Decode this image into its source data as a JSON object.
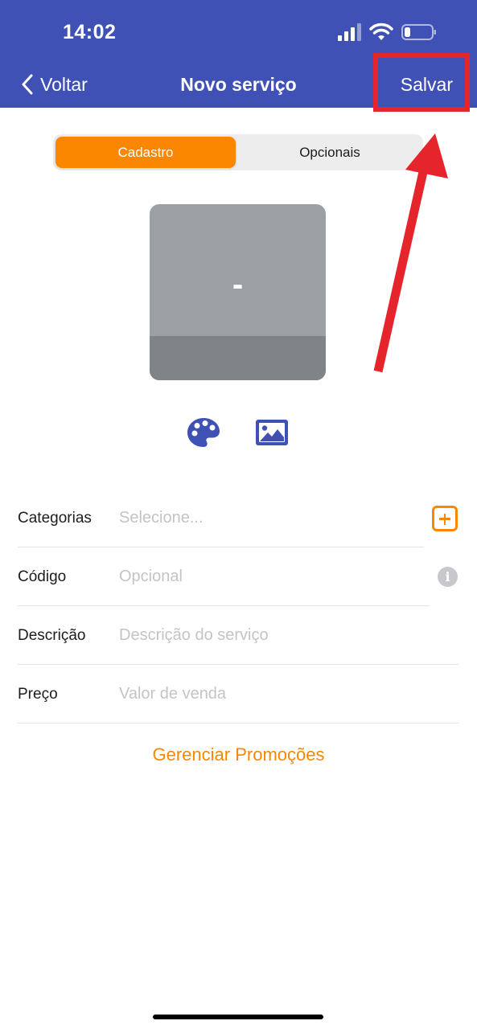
{
  "status_bar": {
    "time": "14:02"
  },
  "nav": {
    "back_label": "Voltar",
    "title": "Novo serviço",
    "save_label": "Salvar"
  },
  "segments": {
    "active": "Cadastro",
    "inactive": "Opcionais"
  },
  "preview": {
    "placeholder": "-"
  },
  "tools": {
    "palette_icon": "palette-icon",
    "image_icon": "image-icon"
  },
  "form": {
    "categorias": {
      "label": "Categorias",
      "placeholder": "Selecione..."
    },
    "codigo": {
      "label": "Código",
      "placeholder": "Opcional"
    },
    "descricao": {
      "label": "Descrição",
      "placeholder": "Descrição do serviço"
    },
    "preco": {
      "label": "Preço",
      "placeholder": "Valor de venda"
    }
  },
  "promo_link": "Gerenciar Promoções",
  "colors": {
    "nav": "#3f51b5",
    "accent": "#fb8700",
    "annotation": "#e5242b"
  }
}
